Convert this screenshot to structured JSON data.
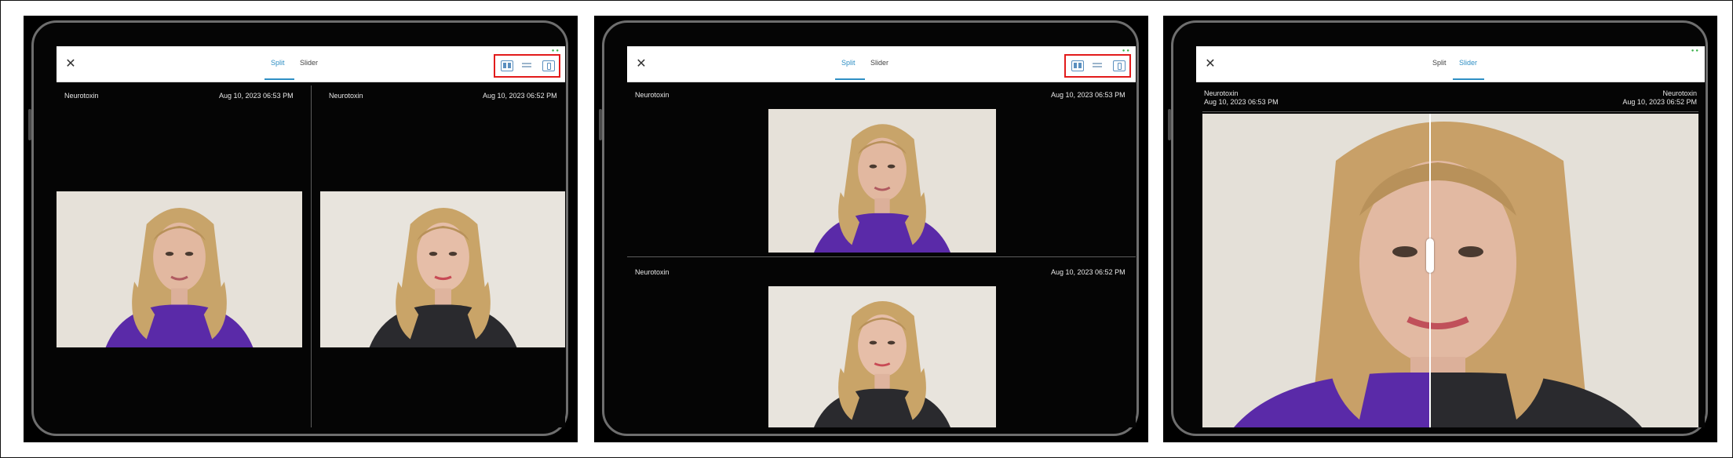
{
  "screens": [
    {
      "layout": "split-horizontal",
      "tabs": [
        {
          "label": "Split",
          "active": true
        },
        {
          "label": "Slider",
          "active": false
        }
      ],
      "left": {
        "label": "Neurotoxin",
        "date": "Aug 10, 2023 06:53 PM"
      },
      "right": {
        "label": "Neurotoxin",
        "date": "Aug 10, 2023 06:52 PM"
      }
    },
    {
      "layout": "split-vertical",
      "tabs": [
        {
          "label": "Split",
          "active": true
        },
        {
          "label": "Slider",
          "active": false
        }
      ],
      "top": {
        "label": "Neurotoxin",
        "date": "Aug 10, 2023 06:53 PM"
      },
      "bottom": {
        "label": "Neurotoxin",
        "date": "Aug 10, 2023 06:52 PM"
      }
    },
    {
      "layout": "slider",
      "tabs": [
        {
          "label": "Split",
          "active": false
        },
        {
          "label": "Slider",
          "active": true
        }
      ],
      "left": {
        "label": "Neurotoxin",
        "date": "Aug 10, 2023 06:53 PM"
      },
      "right": {
        "label": "Neurotoxin",
        "date": "Aug 10, 2023 06:52 PM"
      },
      "slider_position_fraction": 0.46
    }
  ],
  "icons": {
    "close": "close-icon",
    "layout_side_by_side": "side-by-side-layout-icon",
    "layout_stacked": "stacked-layout-icon",
    "export": "share-icon"
  },
  "colors": {
    "accent": "#2f8fc4",
    "highlight_box": "#e21b1b",
    "status_dot": "#3fb24d",
    "screen_bg": "#050505",
    "toolbar_bg": "#ffffff",
    "shirt_purple": "#5a2aa8",
    "shirt_dark": "#2a2a2e"
  }
}
